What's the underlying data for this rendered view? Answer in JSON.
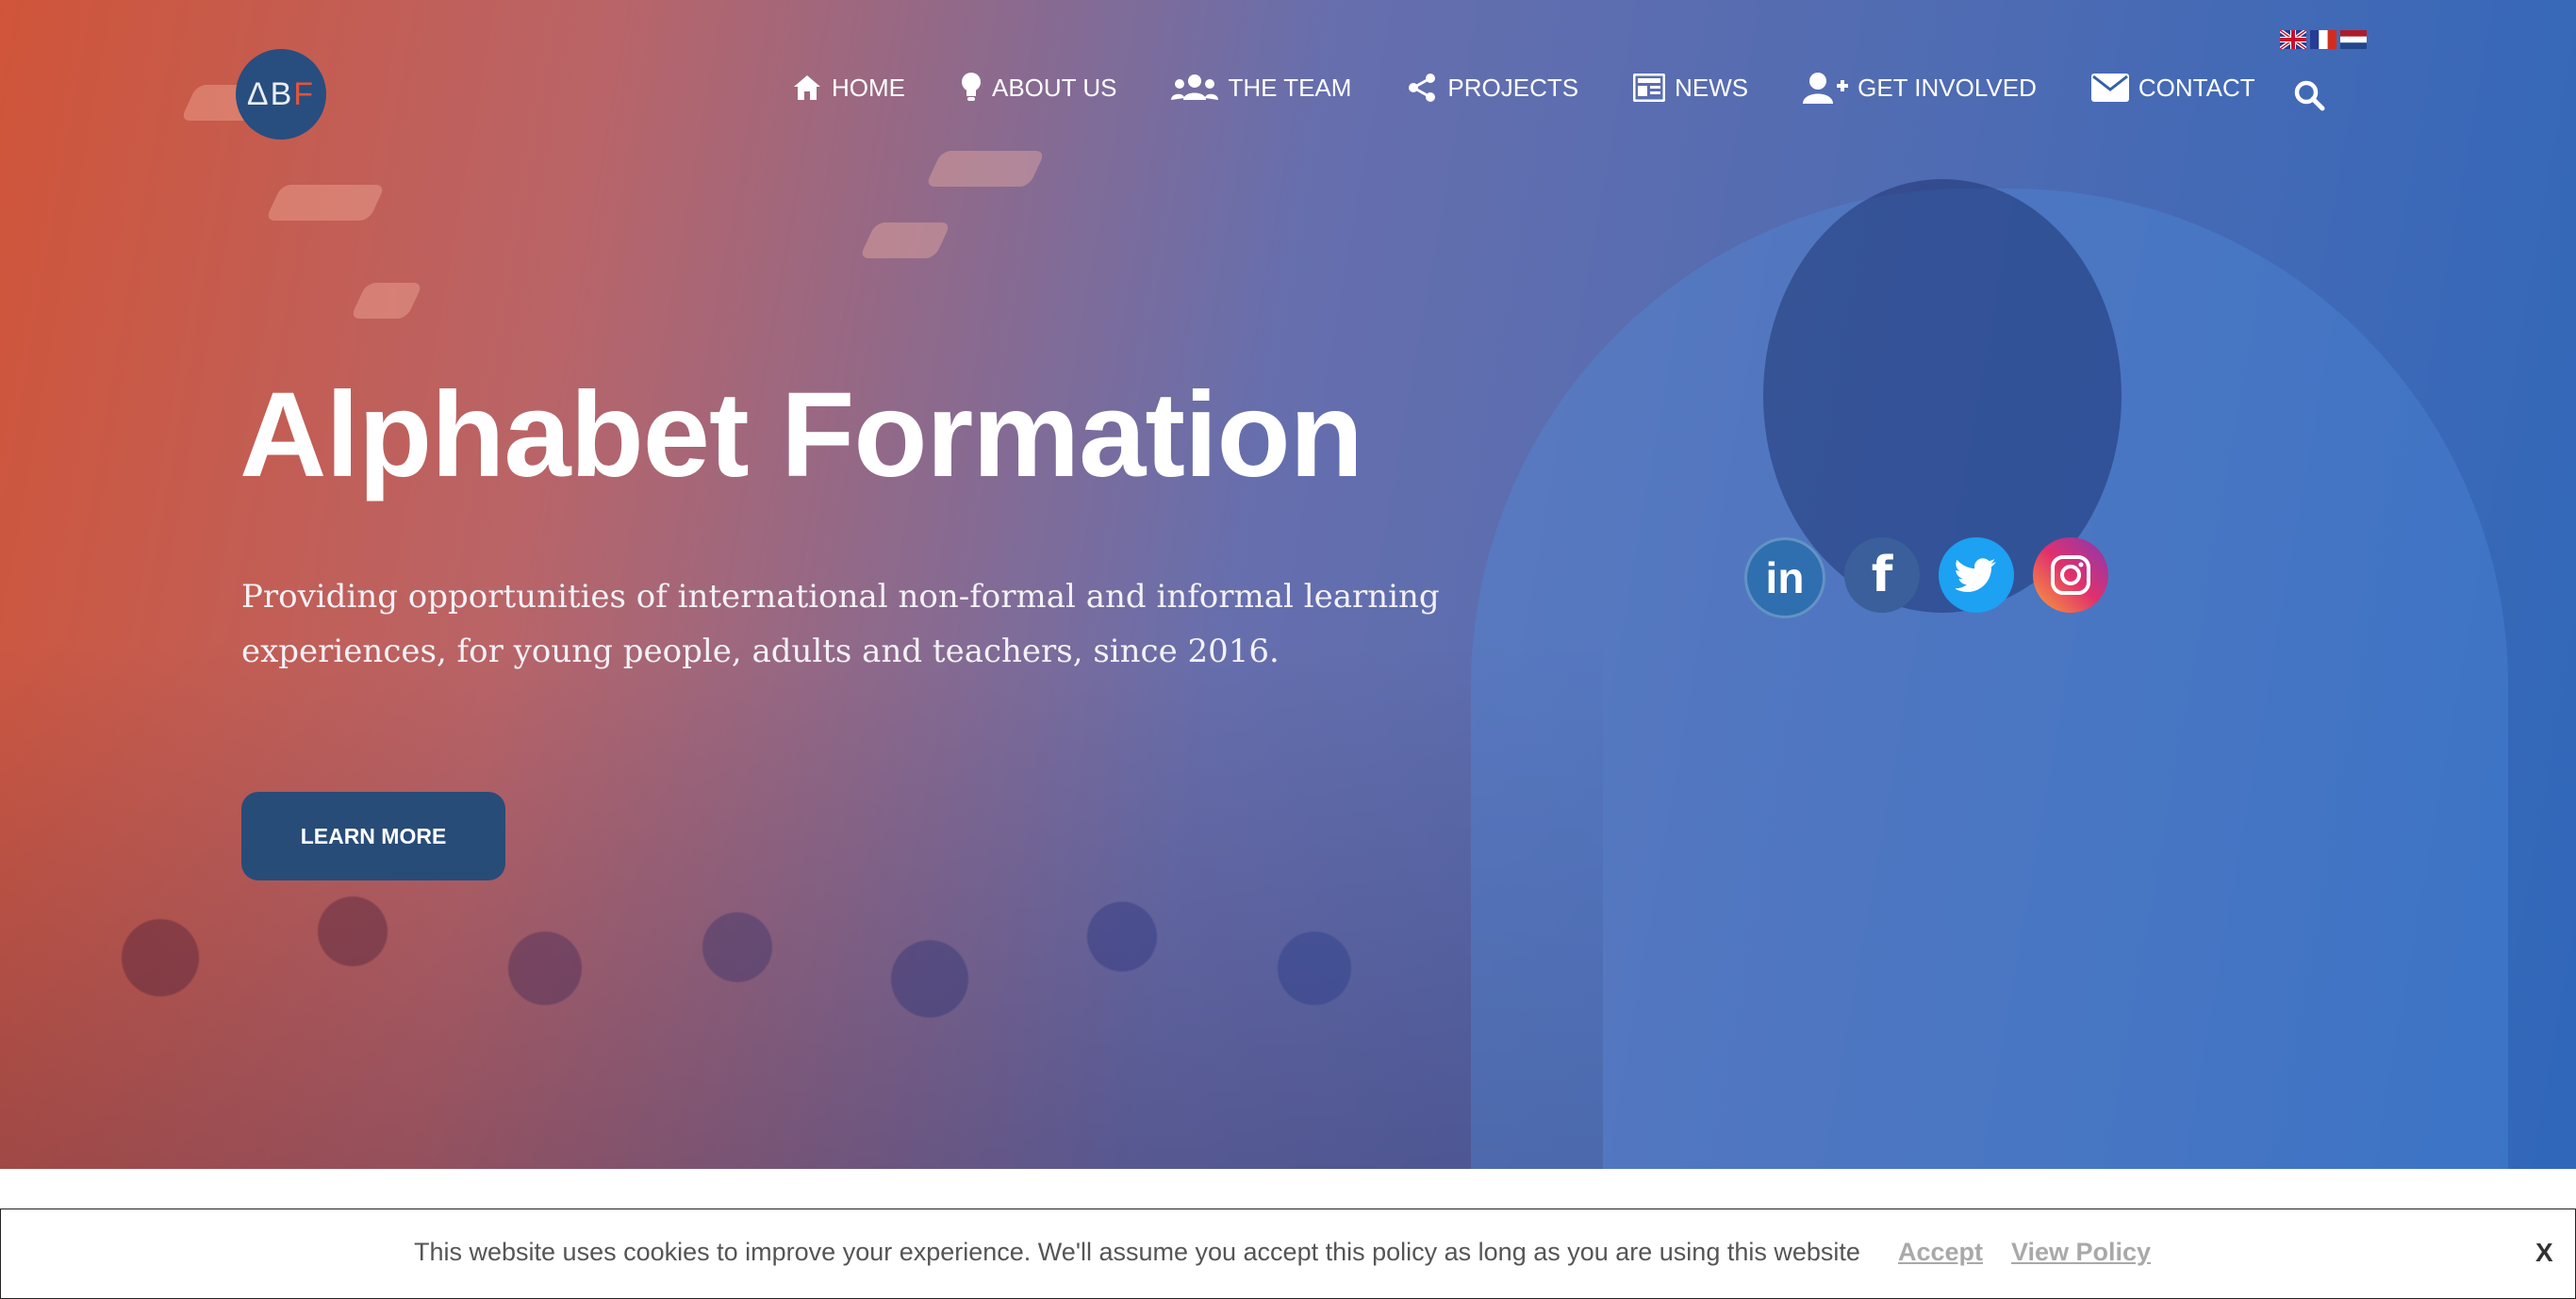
{
  "header": {
    "logo": {
      "letters_main": "ΔB",
      "letters_accent": "F"
    },
    "flags": [
      {
        "name": "uk-flag-icon"
      },
      {
        "name": "fr-flag-icon"
      },
      {
        "name": "nl-flag-icon"
      }
    ],
    "nav": [
      {
        "label": "HOME",
        "icon": "home-icon"
      },
      {
        "label": "ABOUT US",
        "icon": "lightbulb-icon"
      },
      {
        "label": "THE TEAM",
        "icon": "users-icon"
      },
      {
        "label": "PROJECTS",
        "icon": "share-icon"
      },
      {
        "label": "NEWS",
        "icon": "newspaper-icon"
      },
      {
        "label": "GET INVOLVED",
        "icon": "user-plus-icon"
      },
      {
        "label": "CONTACT",
        "icon": "envelope-icon"
      }
    ],
    "search_icon": "search-icon"
  },
  "hero": {
    "title": "Alphabet Formation",
    "subtitle": "Providing opportunities of international non-formal and informal learning experiences, for young people, adults and teachers, since 2016.",
    "cta_label": "LEARN MORE",
    "socials": [
      {
        "name": "linkedin-icon",
        "label": "in",
        "color": "#2f6fb0"
      },
      {
        "name": "facebook-icon",
        "label": "f",
        "color": "#3b5f9a"
      },
      {
        "name": "twitter-icon",
        "label": "",
        "color": "#1da1f2"
      },
      {
        "name": "instagram-icon",
        "label": "",
        "color": "#c13584"
      }
    ]
  },
  "cookie_banner": {
    "text": "This website uses cookies to improve your experience. We'll assume you accept this policy as long as you are using this website",
    "accept_label": "Accept",
    "policy_label": "View Policy",
    "close_label": "X"
  },
  "colors": {
    "button": "#284c78",
    "gradient_start": "#cc4628",
    "gradient_end": "#1e5ab4"
  }
}
